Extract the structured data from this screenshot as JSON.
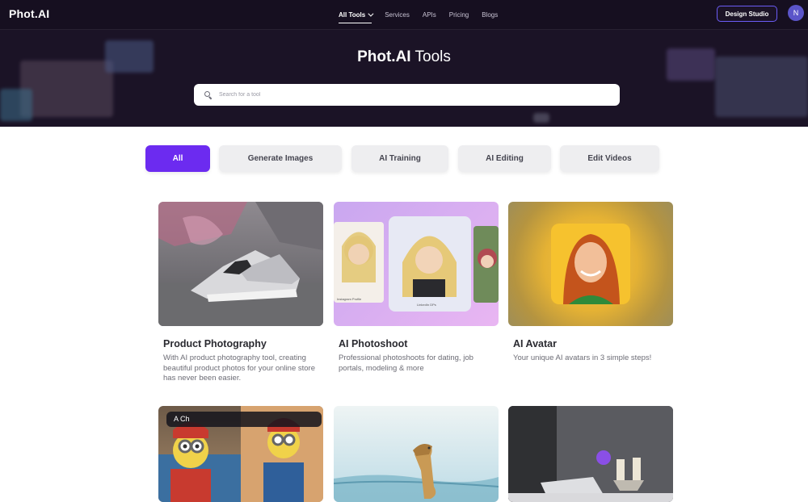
{
  "header": {
    "logo": "Phot.AI",
    "nav": [
      {
        "label": "All Tools",
        "active": true,
        "has_dropdown": true
      },
      {
        "label": "Services",
        "active": false
      },
      {
        "label": "APIs",
        "active": false
      },
      {
        "label": "Pricing",
        "active": false
      },
      {
        "label": "Blogs",
        "active": false
      }
    ],
    "design_studio_label": "Design Studio",
    "avatar_initial": "N"
  },
  "hero": {
    "title_brand": "Phot.AI",
    "title_rest": "Tools",
    "search_placeholder": "Search for a tool"
  },
  "tabs": [
    {
      "label": "All",
      "active": true
    },
    {
      "label": "Generate Images",
      "active": false
    },
    {
      "label": "AI Training",
      "active": false
    },
    {
      "label": "AI Editing",
      "active": false
    },
    {
      "label": "Edit Videos",
      "active": false
    }
  ],
  "cards": [
    {
      "title": "Product Photography",
      "desc": "With AI product photography tool, creating beautiful product photos for your online store has never been easier.",
      "image": "sneaker-photo"
    },
    {
      "title": "AI Photoshoot",
      "desc": "Professional photoshoots for dating, job portals, modeling & more",
      "image": "headshots-collage",
      "image_labels": [
        "Instagram Profile",
        "LinkedIn DPs"
      ]
    },
    {
      "title": "AI Avatar",
      "desc": "Your unique AI avatars in 3 simple steps!",
      "image": "avatar-portrait"
    },
    {
      "title": "",
      "desc": "",
      "image": "minion-characters",
      "image_labels": [
        "A Ch"
      ]
    },
    {
      "title": "",
      "desc": "",
      "image": "dog-watercolor"
    },
    {
      "title": "",
      "desc": "",
      "image": "interior-desk-candles"
    }
  ],
  "colors": {
    "accent": "#6c2bf0",
    "hero_bg": "#1b1326",
    "button_border": "#6b5cf5"
  }
}
